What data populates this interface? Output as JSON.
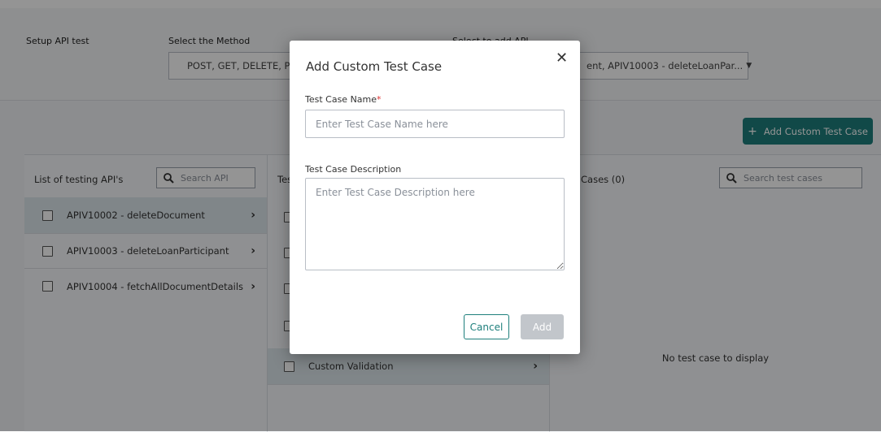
{
  "setup": {
    "title": "Setup API test",
    "method_label": "Select the Method",
    "method_value": "POST, GET, DELETE, PUT",
    "api_label": "Select to add API",
    "api_value": "ent, APIV10003 - deleteLoanPar..."
  },
  "toolbar": {
    "add_custom_label": "Add Custom Test Case"
  },
  "api_list": {
    "header": "List of testing API's",
    "search_placeholder": "Search API",
    "items": [
      {
        "label": "APIV10002 - deleteDocument",
        "selected": true
      },
      {
        "label": "APIV10003 - deleteLoanParticipant",
        "selected": false
      },
      {
        "label": "APIV10004 - fetchAllDocumentDetails",
        "selected": false
      }
    ]
  },
  "middle": {
    "header_fragment": "Tes",
    "custom_validation": "Custom Validation"
  },
  "test_cases": {
    "header": "Cases (0)",
    "search_placeholder": "Search test cases",
    "empty_text": "No test case to display"
  },
  "modal": {
    "title": "Add Custom Test Case",
    "name_label": "Test Case Name",
    "name_required_mark": "*",
    "name_placeholder": "Enter Test Case Name here",
    "desc_label": "Test Case Description",
    "desc_placeholder": "Enter Test Case Description here",
    "cancel_label": "Cancel",
    "add_label": "Add",
    "close_glyph": "✕"
  },
  "colors": {
    "accent": "#1e7f7c",
    "overlay": "rgba(0,0,0,0.42)",
    "disabled": "#c2c6cb"
  },
  "icons": {
    "search": "search-icon",
    "close": "close-icon",
    "chevron": "chevron-right-icon",
    "dropdown": "caret-down-icon",
    "plus": "plus-icon"
  }
}
